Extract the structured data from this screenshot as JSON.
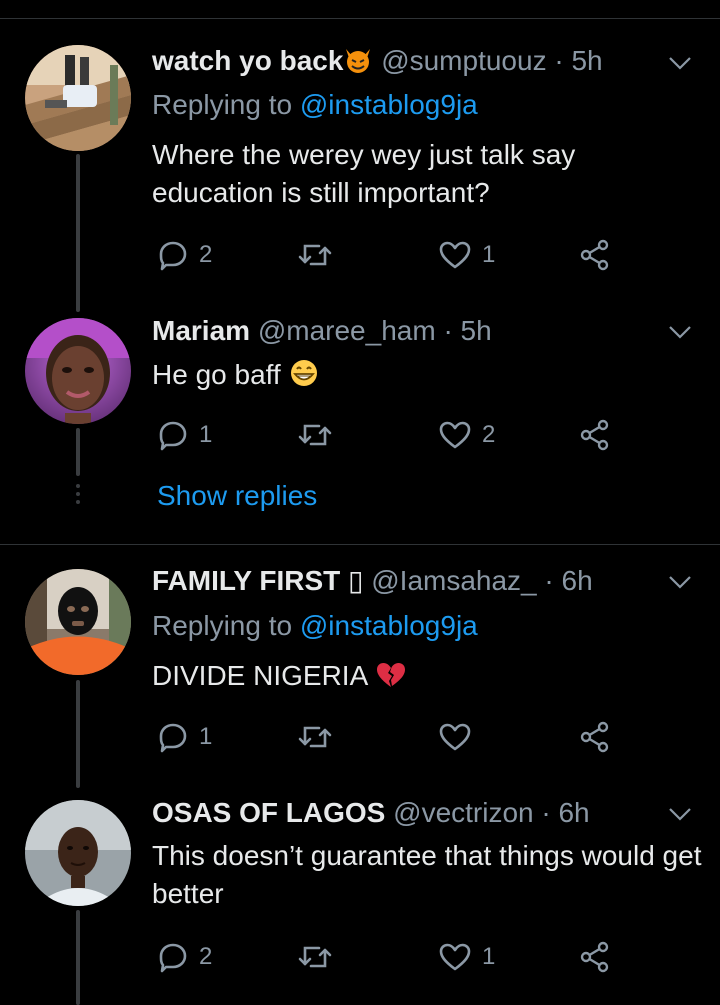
{
  "colors": {
    "background": "#000000",
    "text": "#e7e9ea",
    "secondary": "#8b98a5",
    "link": "#1d9bf0",
    "divider": "#2f3336"
  },
  "icons": {
    "reply": "speech-bubble-icon",
    "retweet": "retweet-icon",
    "like": "heart-icon",
    "share": "share-icon",
    "menu": "chevron-down-icon"
  },
  "tweets": [
    {
      "display_name": "watch yo back",
      "name_emoji": "😈",
      "handle_time": "@sumptuouz · 5h",
      "replying_prefix": "Replying to ",
      "replying_to": "@instablog9ja",
      "text": "Where the werey wey just talk say education is still important?",
      "replies": "2",
      "retweets": "",
      "likes": "1"
    },
    {
      "display_name": "Mariam",
      "handle_time": "@maree_ham · 5h",
      "text": "He go baff",
      "text_emoji": "😁",
      "replies": "1",
      "retweets": "",
      "likes": "2",
      "show_replies": "Show replies"
    },
    {
      "display_name": "FAMILY FIRST",
      "name_suffix": "▯",
      "handle_time": "@Iamsahaz_ · 6h",
      "replying_prefix": "Replying to ",
      "replying_to": "@instablog9ja",
      "text": "DIVIDE NIGERIA",
      "text_emoji": "💔",
      "replies": "1",
      "retweets": "",
      "likes": ""
    },
    {
      "display_name": "OSAS OF LAGOS",
      "handle_time": "@vectrizon · 6h",
      "text": "This doesn’t guarantee that things would get better",
      "replies": "2",
      "retweets": "",
      "likes": "1"
    }
  ]
}
